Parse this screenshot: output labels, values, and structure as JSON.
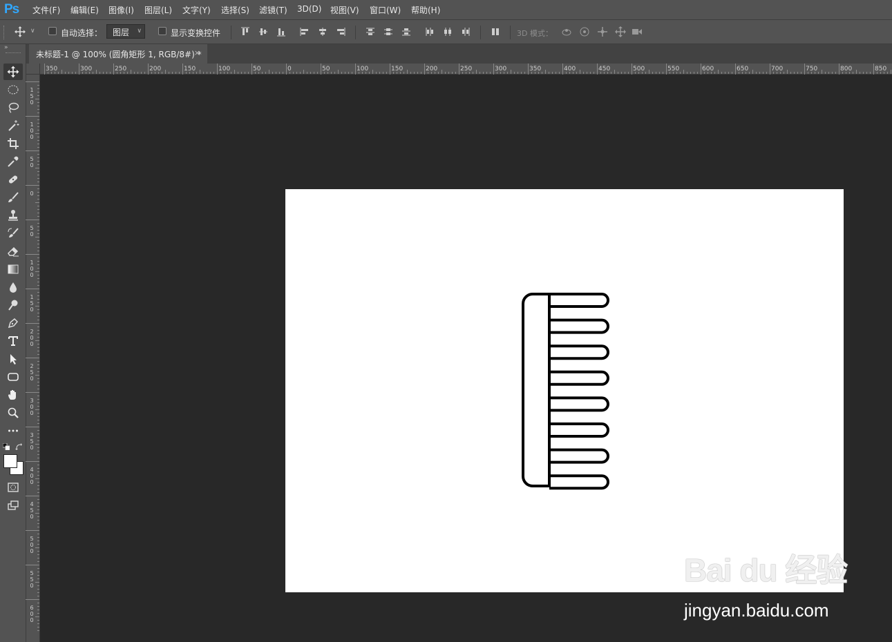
{
  "app": {
    "logo": "Ps"
  },
  "menu": {
    "items": [
      "文件(F)",
      "编辑(E)",
      "图像(I)",
      "图层(L)",
      "文字(Y)",
      "选择(S)",
      "滤镜(T)",
      "3D(D)",
      "视图(V)",
      "窗口(W)",
      "帮助(H)"
    ]
  },
  "options": {
    "auto_select_label": "自动选择：",
    "auto_select_target": "图层",
    "show_transform_label": "显示变换控件",
    "mode_3d_label": "3D 模式："
  },
  "document": {
    "tab_title": "未标题-1 @ 100% (圆角矩形 1, RGB/8#) *",
    "close_glyph": "×",
    "canvas_color": "#ffffff",
    "stroke_color": "#000000"
  },
  "ruler": {
    "h_labels": [
      "350",
      "300",
      "250",
      "200",
      "150",
      "100",
      "50",
      "0",
      "50",
      "100",
      "150",
      "200",
      "250",
      "300",
      "350",
      "400",
      "450",
      "500",
      "550",
      "600",
      "650",
      "700",
      "750",
      "800",
      "850"
    ],
    "v_labels": [
      "150",
      "100",
      "50",
      "0",
      "50",
      "100",
      "150",
      "200",
      "250",
      "300",
      "350",
      "400",
      "450",
      "500",
      "550",
      "600"
    ]
  },
  "watermark": {
    "logo": "Bai du 经验",
    "url": "jingyan.baidu.com"
  },
  "toolbar": {
    "tools": [
      "move-tool-icon",
      "marquee-tool-icon",
      "lasso-tool-icon",
      "magic-wand-icon",
      "crop-tool-icon",
      "eyedropper-icon",
      "healing-brush-icon",
      "brush-tool-icon",
      "clone-stamp-icon",
      "history-brush-icon",
      "eraser-icon",
      "gradient-tool-icon",
      "blur-tool-icon",
      "dodge-tool-icon",
      "pen-tool-icon",
      "type-tool-icon",
      "path-selection-icon",
      "rounded-rectangle-icon",
      "hand-tool-icon",
      "zoom-tool-icon",
      "more-tools-icon"
    ]
  }
}
